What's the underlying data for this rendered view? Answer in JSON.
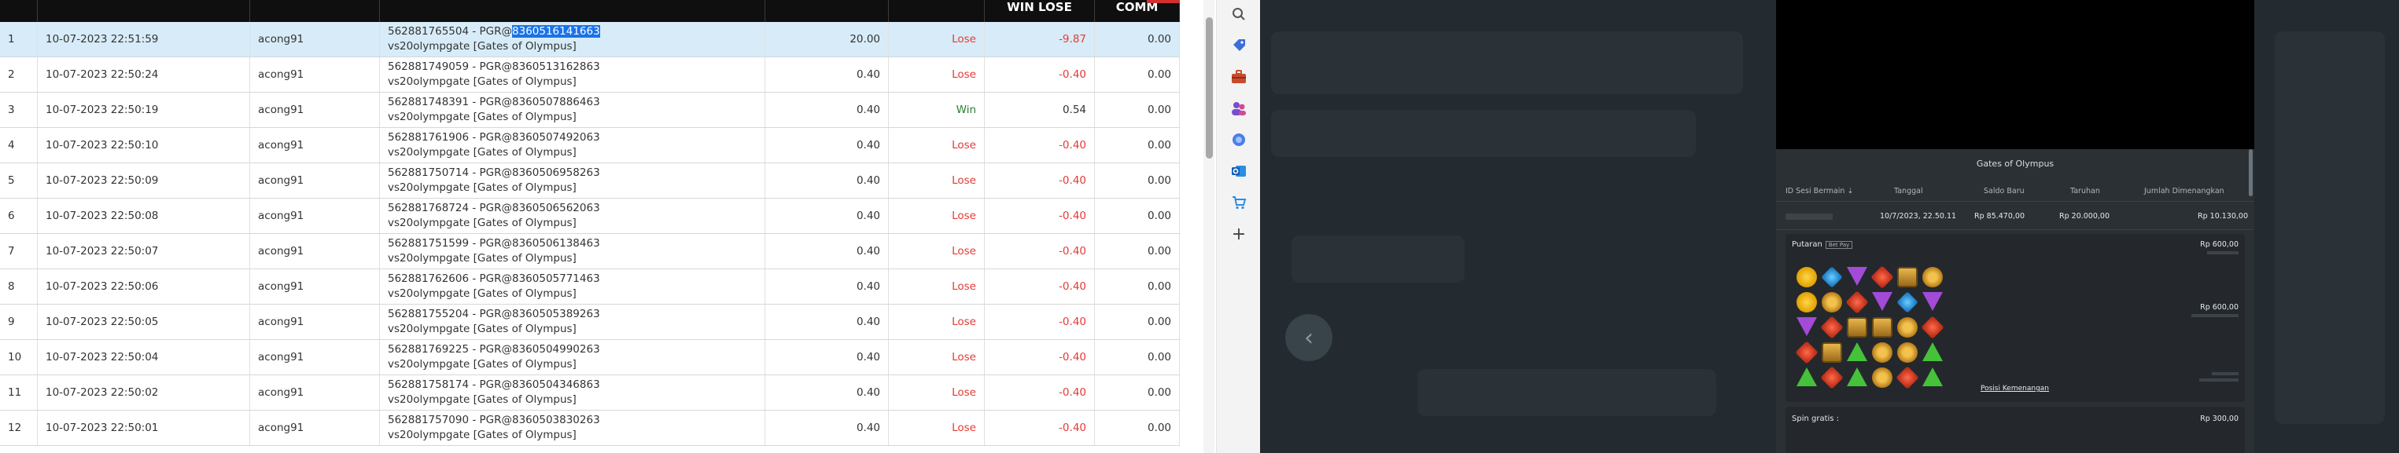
{
  "table": {
    "columns": {
      "win_lose": "WIN LOSE",
      "comm": "COMM"
    },
    "rows": [
      {
        "no": "1",
        "date": "10-07-2023 22:51:59",
        "user": "acong91",
        "id_prefix": "562881765504 - PGR@",
        "id_hl": "8360516141663",
        "game": "vs20olympgate [Gates of Olympus]",
        "bet": "20.00",
        "result": "Lose",
        "winlose": "-9.87",
        "comm": "0.00"
      },
      {
        "no": "2",
        "date": "10-07-2023 22:50:24",
        "user": "acong91",
        "id_prefix": "562881749059 - PGR@8360513162863",
        "id_hl": "",
        "game": "vs20olympgate [Gates of Olympus]",
        "bet": "0.40",
        "result": "Lose",
        "winlose": "-0.40",
        "comm": "0.00"
      },
      {
        "no": "3",
        "date": "10-07-2023 22:50:19",
        "user": "acong91",
        "id_prefix": "562881748391 - PGR@8360507886463",
        "id_hl": "",
        "game": "vs20olympgate [Gates of Olympus]",
        "bet": "0.40",
        "result": "Win",
        "winlose": "0.54",
        "comm": "0.00"
      },
      {
        "no": "4",
        "date": "10-07-2023 22:50:10",
        "user": "acong91",
        "id_prefix": "562881761906 - PGR@8360507492063",
        "id_hl": "",
        "game": "vs20olympgate [Gates of Olympus]",
        "bet": "0.40",
        "result": "Lose",
        "winlose": "-0.40",
        "comm": "0.00"
      },
      {
        "no": "5",
        "date": "10-07-2023 22:50:09",
        "user": "acong91",
        "id_prefix": "562881750714 - PGR@8360506958263",
        "id_hl": "",
        "game": "vs20olympgate [Gates of Olympus]",
        "bet": "0.40",
        "result": "Lose",
        "winlose": "-0.40",
        "comm": "0.00"
      },
      {
        "no": "6",
        "date": "10-07-2023 22:50:08",
        "user": "acong91",
        "id_prefix": "562881768724 - PGR@8360506562063",
        "id_hl": "",
        "game": "vs20olympgate [Gates of Olympus]",
        "bet": "0.40",
        "result": "Lose",
        "winlose": "-0.40",
        "comm": "0.00"
      },
      {
        "no": "7",
        "date": "10-07-2023 22:50:07",
        "user": "acong91",
        "id_prefix": "562881751599 - PGR@8360506138463",
        "id_hl": "",
        "game": "vs20olympgate [Gates of Olympus]",
        "bet": "0.40",
        "result": "Lose",
        "winlose": "-0.40",
        "comm": "0.00"
      },
      {
        "no": "8",
        "date": "10-07-2023 22:50:06",
        "user": "acong91",
        "id_prefix": "562881762606 - PGR@8360505771463",
        "id_hl": "",
        "game": "vs20olympgate [Gates of Olympus]",
        "bet": "0.40",
        "result": "Lose",
        "winlose": "-0.40",
        "comm": "0.00"
      },
      {
        "no": "9",
        "date": "10-07-2023 22:50:05",
        "user": "acong91",
        "id_prefix": "562881755204 - PGR@8360505389263",
        "id_hl": "",
        "game": "vs20olympgate [Gates of Olympus]",
        "bet": "0.40",
        "result": "Lose",
        "winlose": "-0.40",
        "comm": "0.00"
      },
      {
        "no": "10",
        "date": "10-07-2023 22:50:04",
        "user": "acong91",
        "id_prefix": "562881769225 - PGR@8360504990263",
        "id_hl": "",
        "game": "vs20olympgate [Gates of Olympus]",
        "bet": "0.40",
        "result": "Lose",
        "winlose": "-0.40",
        "comm": "0.00"
      },
      {
        "no": "11",
        "date": "10-07-2023 22:50:02",
        "user": "acong91",
        "id_prefix": "562881758174 - PGR@8360504346863",
        "id_hl": "",
        "game": "vs20olympgate [Gates of Olympus]",
        "bet": "0.40",
        "result": "Lose",
        "winlose": "-0.40",
        "comm": "0.00"
      },
      {
        "no": "12",
        "date": "10-07-2023 22:50:01",
        "user": "acong91",
        "id_prefix": "562881757090 - PGR@8360503830263",
        "id_hl": "",
        "game": "vs20olympgate [Gates of Olympus]",
        "bet": "0.40",
        "result": "Lose",
        "winlose": "-0.40",
        "comm": "0.00"
      }
    ]
  },
  "colors": {
    "header_bg": "#0f0f0f",
    "selected_row": "#d7ecf8",
    "highlight": "#1a73e8",
    "lose": "#e53935",
    "win": "#2e7d32",
    "game_bg": "#232a30"
  },
  "sidebar": {
    "icons": [
      "search-icon",
      "tag-icon",
      "briefcase-icon",
      "people-icon",
      "copilot-icon",
      "outlook-icon",
      "shopping-icon",
      "add-icon"
    ]
  },
  "game_detail": {
    "title": "Gates of Olympus",
    "headers": {
      "round_id": "ID Sesi Bermain ⇣",
      "date": "Tanggal",
      "balance": "Saldo Baru",
      "bet": "Taruhan",
      "win_total": "Jumlah Dimenangkan"
    },
    "values": {
      "date": "10/7/2023, 22.50.11",
      "balance": "Rp 85.470,00",
      "bet": "Rp 20.000,00",
      "win_total": "Rp 10.130,00"
    },
    "spin": {
      "label": "Putaran",
      "tag": "Bet Pay",
      "amount1": "Rp 600,00",
      "amount2": "Rp 600,00",
      "link": "Posisi Kemenangan"
    },
    "free_spin": {
      "label": "Spin gratis :",
      "amount": "Rp 300,00"
    }
  }
}
